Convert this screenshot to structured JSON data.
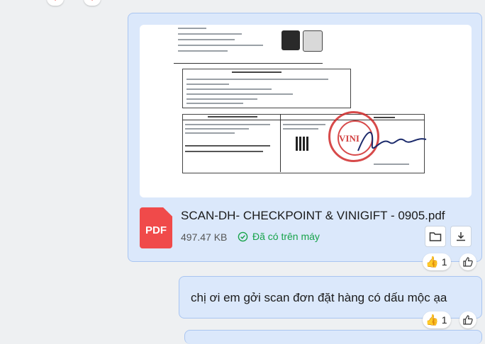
{
  "file_message": {
    "file_name": "SCAN-DH- CHECKPOINT & VINIGIFT - 0905.pdf",
    "file_type_label": "PDF",
    "file_size": "497.47 KB",
    "saved_status": "Đã có trên máy",
    "reaction_count": "1"
  },
  "text_message": {
    "text": "chị ơi em gởi scan đơn đặt hàng có dấu mộc ạa",
    "reaction_count": "1"
  },
  "colors": {
    "bubble_bg": "#dbe8fb",
    "bubble_border": "#a9c5f1",
    "pdf_red": "#f04a4a",
    "saved_green": "#16a34a",
    "stamp_red": "#d12b2b"
  },
  "icons": [
    "heart-icon",
    "pdf-file-icon",
    "check-circle-icon",
    "folder-icon",
    "download-icon",
    "thumbs-up-icon",
    "like-outline-icon"
  ]
}
